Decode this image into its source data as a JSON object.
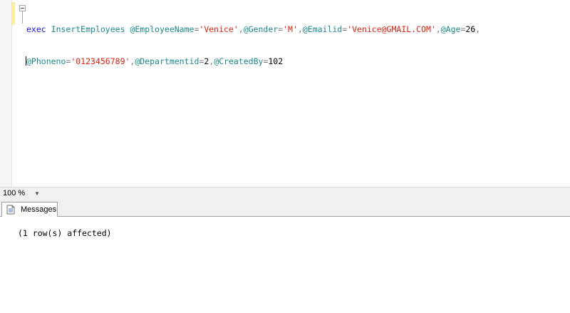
{
  "editor": {
    "line1": {
      "exec": "exec",
      "proc": "InsertEmployees",
      "p1": "@EmployeeName",
      "v1": "'Venice'",
      "p2": "@Gender",
      "v2": "'M'",
      "p3": "@Emailid",
      "v3": "'Venice@GMAIL.COM'",
      "p4": "@Age",
      "v4": "26"
    },
    "line2": {
      "p5": "@Phoneno",
      "v5": "'0123456789'",
      "p6": "@Departmentid",
      "v6": "2",
      "p7": "@CreatedBy",
      "v7": "102"
    }
  },
  "zoom": {
    "value": "100 %"
  },
  "results": {
    "tab_label": "Messages",
    "message": "(1 row(s) affected)"
  },
  "icons": {
    "tab_icon": "messages-document-icon",
    "zoom_chevron": "chevron-down-icon",
    "outline_toggle": "collapse-minus-icon"
  },
  "colors": {
    "keyword": "#1818ff",
    "variable": "#1c8a8a",
    "string": "#e0220f",
    "operator": "#808080",
    "change_marker": "#ffef8c"
  }
}
